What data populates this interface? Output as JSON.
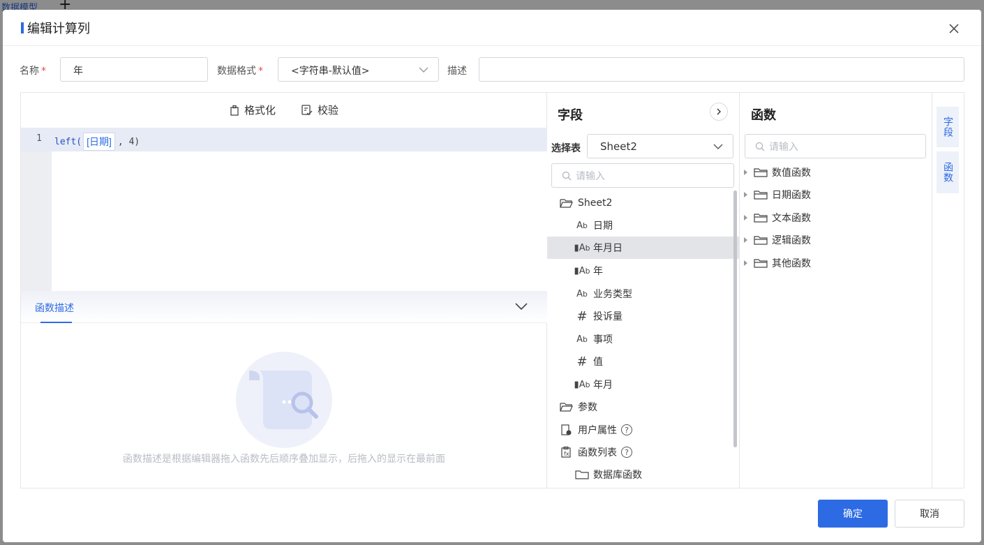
{
  "background": {
    "tab_label": "数据模型"
  },
  "dialog": {
    "title": "编辑计算列",
    "form": {
      "name_label": "名称",
      "name_value": "年",
      "format_label": "数据格式",
      "format_value": "<字符串-默认值>",
      "desc_label": "描述",
      "desc_value": "",
      "required_mark": "*"
    },
    "editor": {
      "format_button": "格式化",
      "validate_button": "校验",
      "line_number": "1",
      "code": {
        "func": "left(",
        "field": "[日期]",
        "rest": ", 4)"
      }
    },
    "function_desc": {
      "tab_label": "函数描述",
      "empty_text": "函数描述是根据编辑器拖入函数先后顺序叠加显示，后拖入的显示在最前面"
    },
    "fields_pane": {
      "title": "字段",
      "select_label": "选择表",
      "select_value": "Sheet2",
      "search_placeholder": "请输入",
      "tree": [
        {
          "label": "Sheet2",
          "icon": "folder-open-icon"
        },
        {
          "label": "日期",
          "icon": "text-type-icon"
        },
        {
          "label": "年月日",
          "icon": "date-text-type-icon"
        },
        {
          "label": "年",
          "icon": "date-text-type-icon"
        },
        {
          "label": "业务类型",
          "icon": "text-type-icon"
        },
        {
          "label": "投诉量",
          "icon": "number-type-icon"
        },
        {
          "label": "事项",
          "icon": "text-type-icon"
        },
        {
          "label": "值",
          "icon": "number-type-icon"
        },
        {
          "label": "年月",
          "icon": "date-text-type-icon"
        },
        {
          "label": "参数",
          "icon": "folder-open-icon"
        },
        {
          "label": "用户属性",
          "icon": "user-attribute-icon"
        },
        {
          "label": "函数列表",
          "icon": "function-list-icon"
        },
        {
          "label": "数据库函数",
          "icon": "folder-icon"
        }
      ]
    },
    "functions_pane": {
      "title": "函数",
      "search_placeholder": "请输入",
      "categories": [
        "数值函数",
        "日期函数",
        "文本函数",
        "逻辑函数",
        "其他函数"
      ]
    },
    "side_tabs": [
      "字段",
      "函数"
    ],
    "buttons": {
      "confirm": "确定",
      "cancel": "取消"
    },
    "accent_color": "#2d6be4"
  }
}
